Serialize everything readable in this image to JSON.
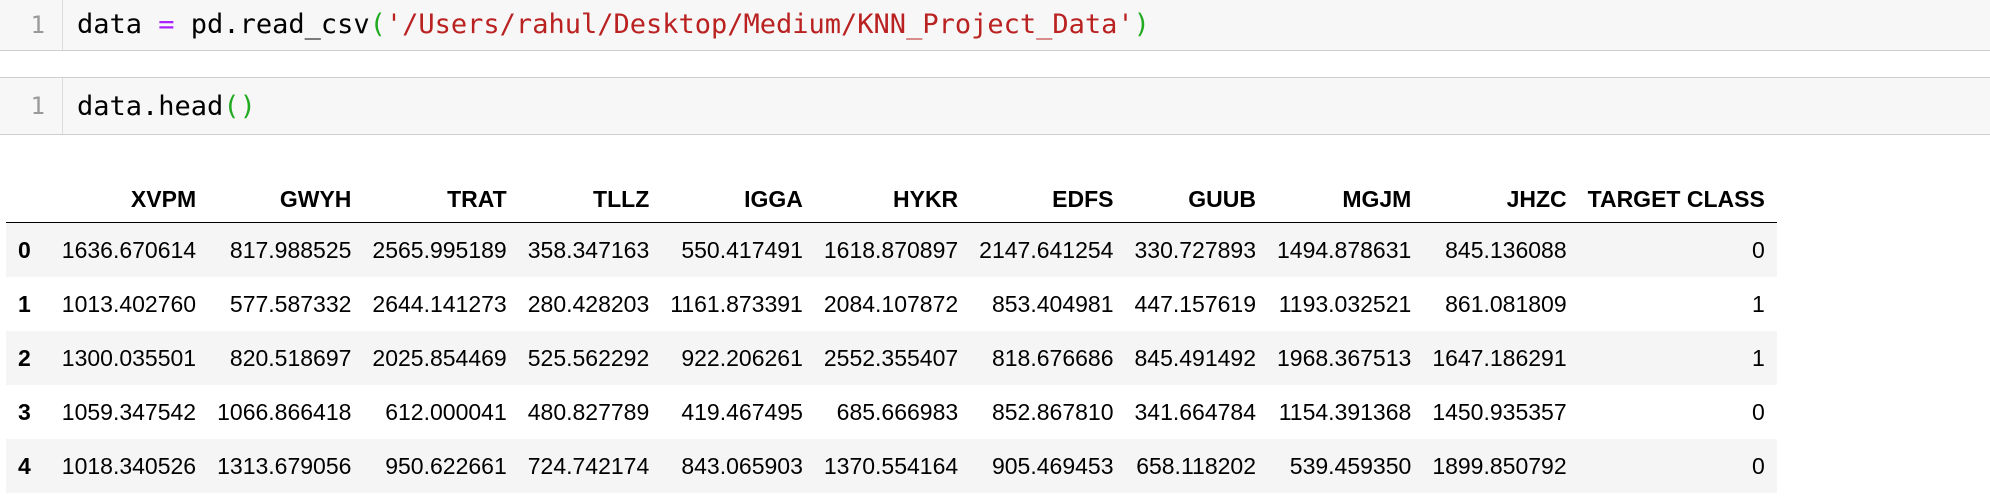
{
  "cells": [
    {
      "line_number": "1",
      "tokens": {
        "var": "data ",
        "op": "=",
        "call": " pd.read_csv",
        "open": "(",
        "str": "'/Users/rahul/Desktop/Medium/KNN_Project_Data'",
        "close": ")"
      }
    },
    {
      "line_number": "1",
      "tokens": {
        "call": "data.head",
        "parens": "()"
      }
    }
  ],
  "dataframe": {
    "index_header": "",
    "columns": [
      "XVPM",
      "GWYH",
      "TRAT",
      "TLLZ",
      "IGGA",
      "HYKR",
      "EDFS",
      "GUUB",
      "MGJM",
      "JHZC",
      "TARGET CLASS"
    ],
    "rows": [
      {
        "index": "0",
        "values": [
          "1636.670614",
          "817.988525",
          "2565.995189",
          "358.347163",
          "550.417491",
          "1618.870897",
          "2147.641254",
          "330.727893",
          "1494.878631",
          "845.136088",
          "0"
        ]
      },
      {
        "index": "1",
        "values": [
          "1013.402760",
          "577.587332",
          "2644.141273",
          "280.428203",
          "1161.873391",
          "2084.107872",
          "853.404981",
          "447.157619",
          "1193.032521",
          "861.081809",
          "1"
        ]
      },
      {
        "index": "2",
        "values": [
          "1300.035501",
          "820.518697",
          "2025.854469",
          "525.562292",
          "922.206261",
          "2552.355407",
          "818.676686",
          "845.491492",
          "1968.367513",
          "1647.186291",
          "1"
        ]
      },
      {
        "index": "3",
        "values": [
          "1059.347542",
          "1066.866418",
          "612.000041",
          "480.827789",
          "419.467495",
          "685.666983",
          "852.867810",
          "341.664784",
          "1154.391368",
          "1450.935357",
          "0"
        ]
      },
      {
        "index": "4",
        "values": [
          "1018.340526",
          "1313.679056",
          "950.622661",
          "724.742174",
          "843.065903",
          "1370.554164",
          "905.469453",
          "658.118202",
          "539.459350",
          "1899.850792",
          "0"
        ]
      }
    ]
  },
  "colors": {
    "operator": "#aa22ff",
    "paren": "#22aa22",
    "string": "#ba2121",
    "cell_background": "#f7f7f7",
    "row_stripe": "#f5f5f5"
  }
}
